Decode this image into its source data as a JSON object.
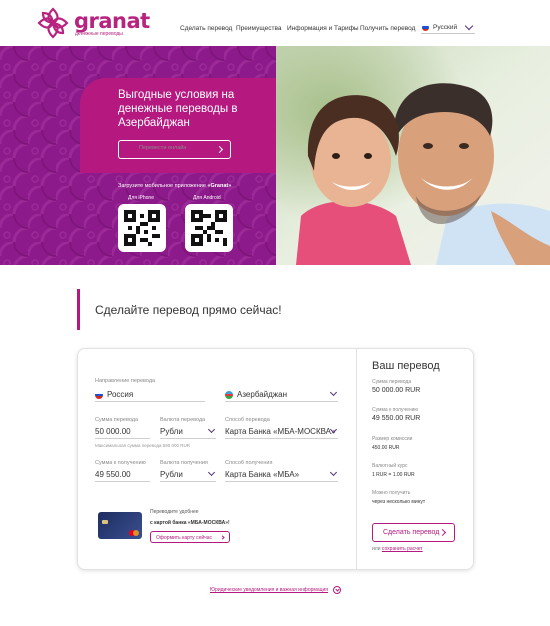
{
  "brand": {
    "name": "granat",
    "tagline": "денежные переводы",
    "color": "#b5197f"
  },
  "nav": {
    "items": [
      "Сделать перевод",
      "Преимущества",
      "Информация и Тарифы",
      "Получить перевод"
    ],
    "language": "Русский"
  },
  "hero": {
    "title": "Выгодные условия на денежные переводы в Азербайджан",
    "cta": "Перевести онлайн",
    "app_note_prefix": "Загрузите мобильное приложение",
    "app_name": "«Granat»",
    "qr_iphone": "Для iPhone",
    "qr_android": "Для Android"
  },
  "section": {
    "title": "Сделайте перевод прямо сейчас!"
  },
  "form": {
    "direction_label": "Направление перевода",
    "from_country": "Россия",
    "to_country": "Азербайджан",
    "send_amount_label": "Сумма перевода",
    "send_amount": "50 000.00",
    "send_hint": "Максимальная сумма перевода 590 000 RUR",
    "send_currency_label": "Валюта перевода",
    "send_currency": "Рубли",
    "send_method_label": "Способ перевода",
    "send_method": "Карта Банка «МБА-МОСКВА»",
    "receive_amount_label": "Сумма к получению",
    "receive_amount": "49 550.00",
    "receive_currency_label": "Валюта получения",
    "receive_currency": "Рубли",
    "receive_method_label": "Способ получения",
    "receive_method": "Карта Банка «МБА»",
    "promo_line1": "Переводите удобнее",
    "promo_line2": "с картой банка «МБА-МОСКВА»!",
    "promo_button": "Оформить карту сейчас"
  },
  "summary": {
    "title": "Ваш перевод",
    "send_label": "Сумма перевода",
    "send_value": "50 000.00 RUR",
    "receive_label": "Сумма к получению",
    "receive_value": "49 550.00 RUR",
    "fee_label": "Размер комиссии",
    "fee_value": "450.00 RUR",
    "rate_label": "Валютный курс",
    "rate_value": "1 RUR = 1.00 RUR",
    "time_label": "Можно получить",
    "time_value": "через несколько минут",
    "send_button": "Сделать перевод",
    "or_text": "или",
    "save_link": "сохранить расчет"
  },
  "footer": {
    "legal_link": "Юридические уведомления и важная информация"
  }
}
